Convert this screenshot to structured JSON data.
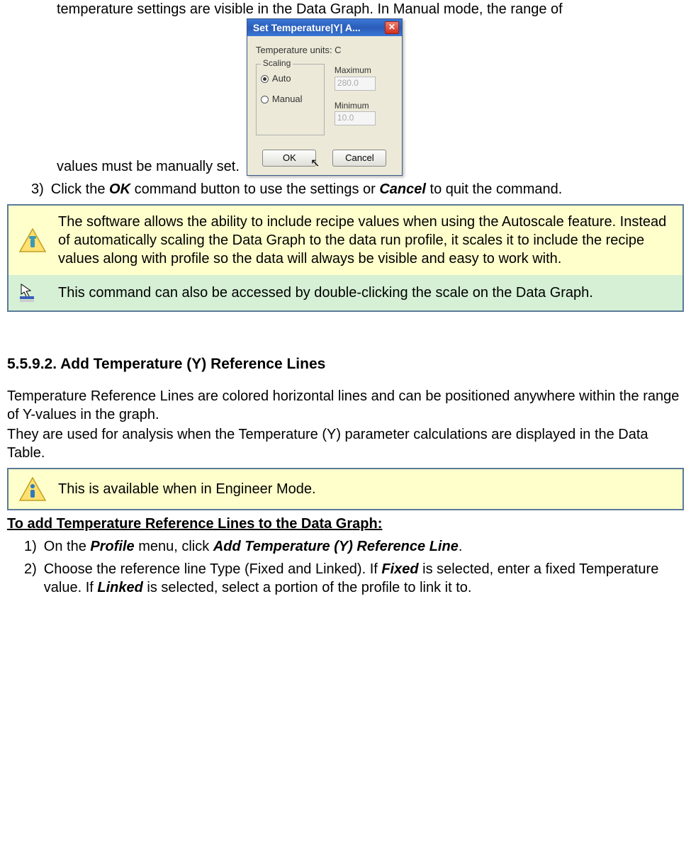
{
  "intro": {
    "frag_top": "temperature settings are visible in the Data Graph. In Manual mode, the range of",
    "frag_bottom": "values must be manually set."
  },
  "dialog": {
    "title": "Set Temperature|Y| A...",
    "units_label": "Temperature units: C",
    "scaling_label": "Scaling",
    "radio_auto": "Auto",
    "radio_manual": "Manual",
    "max_label": "Maximum",
    "max_value": "280.0",
    "min_label": "Minimum",
    "min_value": "10.0",
    "ok": "OK",
    "cancel": "Cancel"
  },
  "step3": {
    "num": "3)",
    "text_a": "Click the ",
    "ok": "OK",
    "text_b": " command button to use the settings or ",
    "cancel": "Cancel",
    "text_c": " to quit the command."
  },
  "notes": {
    "tip": "The software allows the ability to include recipe values when using the Autoscale feature. Instead of automatically scaling the Data Graph to the data run profile, it scales it to include the recipe values along with profile so the data will always be visible and easy to work with.",
    "click": "This command can also be accessed by double-clicking the scale on the Data Graph."
  },
  "section": {
    "heading": "5.5.9.2. Add Temperature (Y) Reference Lines",
    "p1": "Temperature Reference Lines are colored horizontal lines and can be positioned anywhere within the range of Y-values in the graph.",
    "p2": "They are used for analysis when the Temperature (Y) parameter calculations are displayed in the Data Table."
  },
  "note2": {
    "text": "This is available when in Engineer Mode."
  },
  "procedure": {
    "title": "To add Temperature Reference Lines to the Data Graph:",
    "s1": {
      "num": "1)",
      "a": "On the ",
      "profile": "Profile",
      "b": " menu, click ",
      "add": "Add Temperature (Y) Reference Line",
      "c": "."
    },
    "s2": {
      "num": "2)",
      "a": "Choose the reference line Type (Fixed and Linked). If ",
      "fixed": "Fixed",
      "b": " is selected, enter a fixed Temperature value. If ",
      "linked": "Linked",
      "c": " is selected, select a portion of the profile to link it to."
    }
  }
}
